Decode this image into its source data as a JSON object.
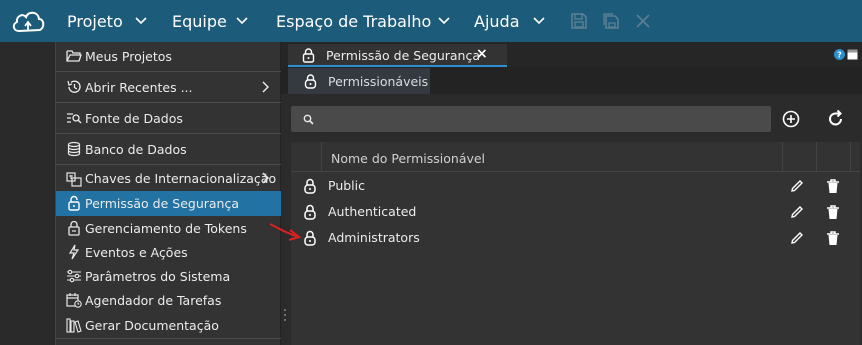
{
  "menubar": {
    "items": [
      "Projeto",
      "Equipe",
      "Espaço de Trabalho",
      "Ajuda"
    ],
    "toolbar_icons": [
      "save-icon",
      "save-all-icon",
      "close-icon"
    ],
    "logo": "cloud-logo"
  },
  "dropdown": {
    "items": [
      {
        "label": "Meus Projetos",
        "icon": "folder-open-icon"
      },
      {
        "label": "Abrir Recentes ...",
        "icon": "history-icon",
        "submenu": true
      },
      {
        "label": "Fonte de Dados",
        "icon": "datasource-search-icon"
      },
      {
        "label": "Banco de Dados",
        "icon": "database-icon"
      },
      {
        "label": "Chaves de Internacionalização",
        "icon": "translate-icon",
        "submenu": true
      },
      {
        "label": "Permissão de Segurança",
        "icon": "lock-icon",
        "active": true
      },
      {
        "label": "Gerenciamento de Tokens",
        "icon": "token-lock-icon"
      },
      {
        "label": "Eventos e Ações",
        "icon": "lightning-icon"
      },
      {
        "label": "Parâmetros do Sistema",
        "icon": "sliders-icon"
      },
      {
        "label": "Agendador de Tarefas",
        "icon": "calendar-clock-icon"
      },
      {
        "label": "Gerar Documentação",
        "icon": "books-icon"
      }
    ]
  },
  "main": {
    "tab": {
      "label": "Permissão de Segurança",
      "close": "×"
    },
    "subtab": {
      "label": "Permissionáveis"
    },
    "search": {
      "placeholder": ""
    },
    "table": {
      "header": "Nome do Permissionável",
      "rows": [
        "Public",
        "Authenticated",
        "Administrators"
      ]
    }
  },
  "colors": {
    "topbar": "#1d5b7a",
    "active_item": "#2272a3",
    "tab_underline": "#2b8fd1",
    "annotation_arrow": "#e02020"
  }
}
